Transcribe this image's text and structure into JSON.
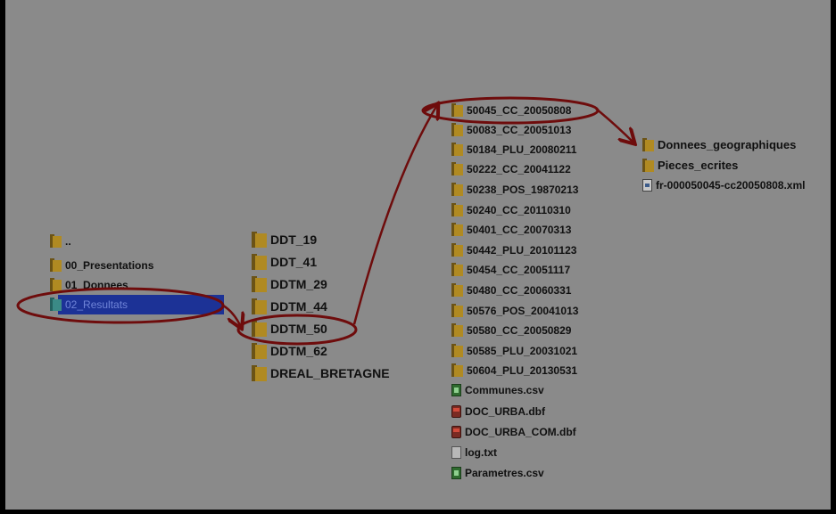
{
  "colors": {
    "background": "#8a8a8a",
    "outer": "#000000",
    "folder": "#b08a22",
    "annotation": "#6e0c0c",
    "selection": "#1c3296"
  },
  "column1": {
    "items": [
      {
        "label": "..",
        "icon": "folder-icon"
      },
      {
        "label": "00_Presentations",
        "icon": "folder-icon"
      },
      {
        "label": "01_Donnees",
        "icon": "folder-icon"
      },
      {
        "label": "02_Resultats",
        "icon": "folder-icon",
        "selected": true
      }
    ]
  },
  "column2": {
    "items": [
      {
        "label": "DDT_19",
        "icon": "folder-icon"
      },
      {
        "label": "DDT_41",
        "icon": "folder-icon"
      },
      {
        "label": "DDTM_29",
        "icon": "folder-icon"
      },
      {
        "label": "DDTM_44",
        "icon": "folder-icon"
      },
      {
        "label": "DDTM_50",
        "icon": "folder-icon"
      },
      {
        "label": "DDTM_62",
        "icon": "folder-icon"
      },
      {
        "label": "DREAL_BRETAGNE",
        "icon": "folder-icon"
      }
    ]
  },
  "column3": {
    "items": [
      {
        "label": "50045_CC_20050808",
        "icon": "folder-icon"
      },
      {
        "label": "50083_CC_20051013",
        "icon": "folder-icon"
      },
      {
        "label": "50184_PLU_20080211",
        "icon": "folder-icon"
      },
      {
        "label": "50222_CC_20041122",
        "icon": "folder-icon"
      },
      {
        "label": "50238_POS_19870213",
        "icon": "folder-icon"
      },
      {
        "label": "50240_CC_20110310",
        "icon": "folder-icon"
      },
      {
        "label": "50401_CC_20070313",
        "icon": "folder-icon"
      },
      {
        "label": "50442_PLU_20101123",
        "icon": "folder-icon"
      },
      {
        "label": "50454_CC_20051117",
        "icon": "folder-icon"
      },
      {
        "label": "50480_CC_20060331",
        "icon": "folder-icon"
      },
      {
        "label": "50576_POS_20041013",
        "icon": "folder-icon"
      },
      {
        "label": "50580_CC_20050829",
        "icon": "folder-icon"
      },
      {
        "label": "50585_PLU_20031021",
        "icon": "folder-icon"
      },
      {
        "label": "50604_PLU_20130531",
        "icon": "folder-icon"
      },
      {
        "label": "Communes.csv",
        "icon": "csv-file-icon"
      },
      {
        "label": "DOC_URBA.dbf",
        "icon": "dbf-file-icon"
      },
      {
        "label": "DOC_URBA_COM.dbf",
        "icon": "dbf-file-icon"
      },
      {
        "label": "log.txt",
        "icon": "text-file-icon"
      },
      {
        "label": "Parametres.csv",
        "icon": "csv-file-icon"
      }
    ]
  },
  "column4": {
    "items": [
      {
        "label": "Donnees_geographiques",
        "icon": "folder-icon"
      },
      {
        "label": "Pieces_ecrites",
        "icon": "folder-icon"
      },
      {
        "label": "fr-000050045-cc20050808.xml",
        "icon": "xml-file-icon"
      }
    ]
  }
}
